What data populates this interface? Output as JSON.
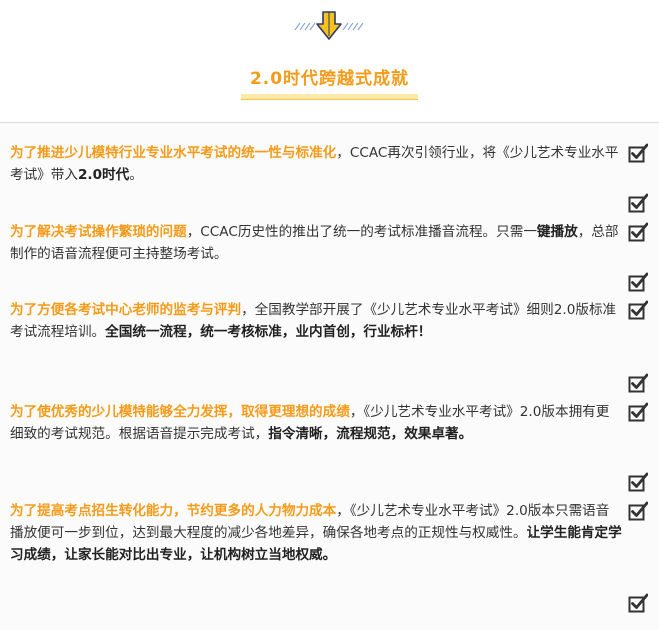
{
  "header": {
    "icon": "arrow-down-icon",
    "title": "2.0时代跨越式成就"
  },
  "colors": {
    "accent": "#f59b1a",
    "icon_yellow": "#f7c21b",
    "icon_blue": "#2d3a6b",
    "stripes": "#8fa6d6"
  },
  "items": [
    {
      "highlight": "为了推进少儿模特行业专业水平考试的统一性与标准化",
      "text1": "，CCAC再次引领行业，将《少儿艺术专业水平考试》带入",
      "bold1": "2.0时代",
      "text2": "。",
      "bold2": ""
    },
    {
      "highlight": "为了解决考试操作繁琐的问题",
      "text1": "，CCAC历史性的推出了统一的考试标准播音流程。只需一",
      "bold1": "键播放",
      "text2": "，总部制作的语音流程便可主持整场考试。",
      "bold2": ""
    },
    {
      "highlight": "为了方便各考试中心老师的监考与评判",
      "text1": "，全国教学部开展了《少儿艺术专业水平考试》细则2.0版标准考试流程培训。",
      "bold1": "全国统一流程，统一考核标准，业内首创，行业标杆！",
      "text2": "",
      "bold2": ""
    },
    {
      "highlight": "为了使优秀的少儿模特能够全力发挥，取得更理想的成绩",
      "text1": "，《少儿艺术专业水平考试》2.0版本拥有更细致的考试规范。根据语音提示完成考试，",
      "bold1": "指令清晰，流程规范，效果卓著。",
      "text2": "",
      "bold2": ""
    },
    {
      "highlight": "为了提高考点招生转化能力，节约更多的人力物力成本",
      "text1": "，《少儿艺术专业水平考试》2.0版本只需语音播放便可一步到位，达到最大程度的减少各地差异，确保各地考点的正规性与权威性。",
      "bold1": "让学生能肯定学习成绩，让家长能对比出专业，让机构树立当地权威。",
      "text2": "",
      "bold2": ""
    }
  ],
  "checkbox_icon": "checked-box-icon"
}
